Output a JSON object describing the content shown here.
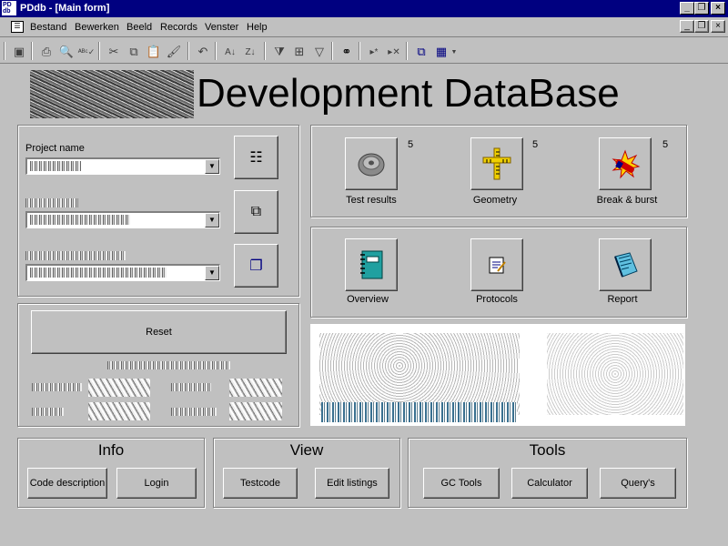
{
  "window": {
    "title": "PDdb - [Main form]",
    "icon_label": "PD db"
  },
  "menu": {
    "items": [
      "Bestand",
      "Bewerken",
      "Beeld",
      "Records",
      "Venster",
      "Help"
    ]
  },
  "form": {
    "heading": "Development DataBase",
    "project_name_label": "Project name",
    "reset_label": "Reset"
  },
  "actions_top": [
    {
      "label": "Test results",
      "count": "5",
      "icon": "disc-icon"
    },
    {
      "label": "Geometry",
      "count": "5",
      "icon": "ruler-icon"
    },
    {
      "label": "Break & burst",
      "count": "5",
      "icon": "burst-icon"
    }
  ],
  "actions_bottom": [
    {
      "label": "Overview",
      "icon": "notebook-icon"
    },
    {
      "label": "Protocols",
      "icon": "notepad-icon"
    },
    {
      "label": "Report",
      "icon": "report-icon"
    }
  ],
  "groups": {
    "info": {
      "title": "Info",
      "buttons": [
        "Code description",
        "Login"
      ]
    },
    "view": {
      "title": "View",
      "buttons": [
        "Testcode",
        "Edit listings"
      ]
    },
    "tools": {
      "title": "Tools",
      "buttons": [
        "GC Tools",
        "Calculator",
        "Query's"
      ]
    }
  },
  "colors": {
    "titlebar": "#000080",
    "face": "#c0c0c0"
  }
}
